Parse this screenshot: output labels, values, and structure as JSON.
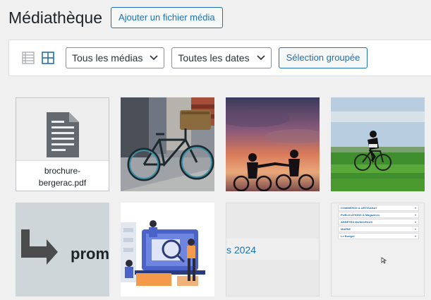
{
  "header": {
    "title": "Médiathèque",
    "add_button": "Ajouter un fichier média"
  },
  "toolbar": {
    "view_list": "list-view-icon",
    "view_grid": "grid-view-icon",
    "filter_type": "Tous les médias",
    "filter_date": "Toutes les dates",
    "bulk_select": "Sélection groupée"
  },
  "media": {
    "items": [
      {
        "kind": "file",
        "name": "brochure-bergerac.pdf",
        "name_line1": "brochure-",
        "name_line2": "bergerac.pdf"
      },
      {
        "kind": "image",
        "subject": "bicycle parked on street"
      },
      {
        "kind": "image",
        "subject": "cyclists silhouette at sunset"
      },
      {
        "kind": "image",
        "subject": "cyclist riding in field"
      },
      {
        "kind": "image",
        "subject": "promo arrow graphic",
        "text": "prom"
      },
      {
        "kind": "image",
        "subject": "illustration people at computer"
      },
      {
        "kind": "image",
        "subject": "2024 banner",
        "text": "s 2024"
      },
      {
        "kind": "image",
        "subject": "menu screenshot",
        "rows": [
          "COMMERCE & ARTISANAT",
          "PUBLICATIONS & Magazines",
          "ARRÊTÉS MUNICIPAUX",
          "MAIRIE",
          "Le Budget"
        ]
      }
    ]
  },
  "colors": {
    "accent": "#2271b1",
    "background": "#f0f0f1"
  }
}
